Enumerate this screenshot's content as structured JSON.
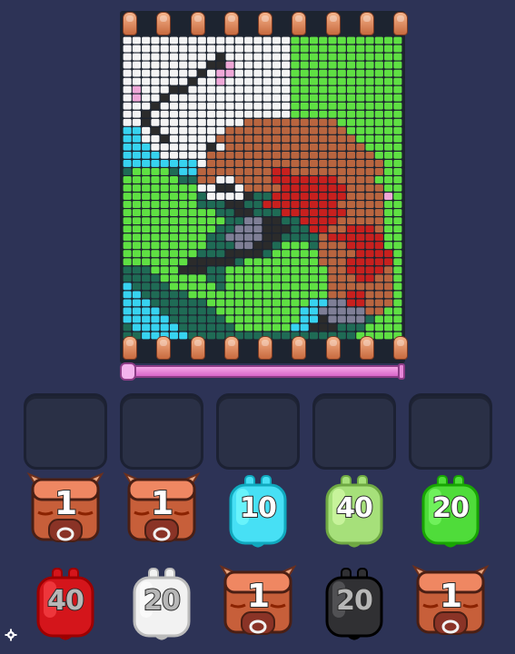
{
  "board": {
    "rows": [
      "WWWWWWWWWWWWWWWWWWGGGGGGGGGGGG",
      "WWWWWWWWWWWWWWWWWWGGGGGGGGGGGG",
      "WWWWWWWWWWKWWWWWWWGGGGGGGGGGGG",
      "WWWWWWWWWKKPWWWWWWGGGGGGGGGGGG",
      "WWWWWWWWKWPPWWWWWWGGGGGGGGGGGG",
      "WWWWWWWKWWPWWWWWWWGGGGGGGGGGGG",
      "WPWWWKKWWWWWWWWWWWGGGGGGGGGGGG",
      "WPWWKWWWWWWWWWWWWWGGGGGGGGGGGG",
      "WWWKWWWWWWWWWWWWWWGGGGGGGGGGGG",
      "WWKWWWWWWWWWWWWWWWGGGGGGGGGGGG",
      "WWKWWWWWWWWWWBBBBBBBBBBGGGGGGG",
      "CCWKWWWWWWWBBBBBBBBBBBBBGGGGGG",
      "CCWWKWWWWWBBBBBBBBBBBBBBBGGGGG",
      "CCCWWWWWWKWBBBBBBBBBBBBBBBGGGG",
      "CCCCWWWWWBBBBBBBBBBBBBBBBBBGGG",
      "CCCCCCCCWBBBBBBBBBBBBBBBBBBBGG",
      "DGGGGDCCBBBBBBBBRRBBBBBBBBBBGG",
      "GGGGGGDDBBWWBBBBRRRRRRRBBBBGGG",
      "GGGGGGGGWWKKWBBBBRRRRRRRBBBBGG",
      "GGGGGGGGDWWWWKDDRRRRRRRRBBBBPG",
      "GGGGGGGGDDDKKDDRRRRRRRRBBBBBGG",
      "GGGGGGGGGGDDKKDDDRRRRRRRBBBBGG",
      "GGGGGGGGGGGDDLLKKDDRRRRBBBBBGG",
      "GGGGGGGGGGDDLLLKKKDDRRBBRRRBGG",
      "GGGGGGGGGDDLLLLKKDDDDBRRRRRRGG",
      "GGGGGGGGGDDDLLKKDGGGDBBBRRRRGG",
      "GGGGGGGGDDDKKKKDGGGGGBBBBRRRRG",
      "GGGGGGGKKKKKDGGGGGGGGBBBRRRRRG",
      "DDDGGGKKKDDGGGGGGGGGGGBBRRRRBG",
      "DDDDGGGGGDDGGGGGGGGGGGBBBRRBBG",
      "CDDDDGGGGGDGGGGGGGGGGGBBBBBBBG",
      "CCDDDDDGGGGGGGGGGGGGGGBBRRBBBG",
      "CCCDDDDDDGGGGGGGGGGGCCLLRRBBBG",
      "CCCCDDDDDDGGGGGGGGGCCLLLLLBBGG",
      "CCCCCDDDDDDGGGGGGGGCCKLLLLDGGG",
      "DCCCCCDDDDDDGGGGGGCCKKKDDDGGGG",
      "DDCCCCCDDDDDDDDDDDDDDDDDDGGGGG"
    ],
    "palette": {
      "W": "#f4f4f4",
      "G": "#5fe043",
      "K": "#2b2b2b",
      "P": "#f0a8d8",
      "C": "#37d3f0",
      "B": "#b9653f",
      "R": "#c8201e",
      "D": "#1f6b55",
      "L": "#7f7f96"
    },
    "cell_count_x": 30,
    "cell_count_y": 37
  },
  "pegs": {
    "count": 16,
    "color": "#e0855a"
  },
  "rail": {
    "color": "#e27bd6",
    "progress": 0
  },
  "slots": {
    "count": 5,
    "filled": 0
  },
  "pieces_row1": [
    {
      "type": "bull",
      "label": "1",
      "color": "#c75f3a"
    },
    {
      "type": "bull",
      "label": "1",
      "color": "#c75f3a"
    },
    {
      "type": "jar",
      "label": "10",
      "color": "#47e0f5"
    },
    {
      "type": "jar",
      "label": "40",
      "color": "#a6e07a"
    },
    {
      "type": "jar",
      "label": "20",
      "color": "#4fdc3a"
    }
  ],
  "pieces_row2": [
    {
      "type": "jar",
      "label": "40",
      "color": "#d4151b",
      "dim": true
    },
    {
      "type": "jar",
      "label": "20",
      "color": "#f2f2f2",
      "dim": true
    },
    {
      "type": "bull",
      "label": "1",
      "color": "#c75f3a"
    },
    {
      "type": "jar",
      "label": "20",
      "color": "#303033",
      "dim": true
    },
    {
      "type": "bull",
      "label": "1",
      "color": "#c75f3a"
    }
  ]
}
